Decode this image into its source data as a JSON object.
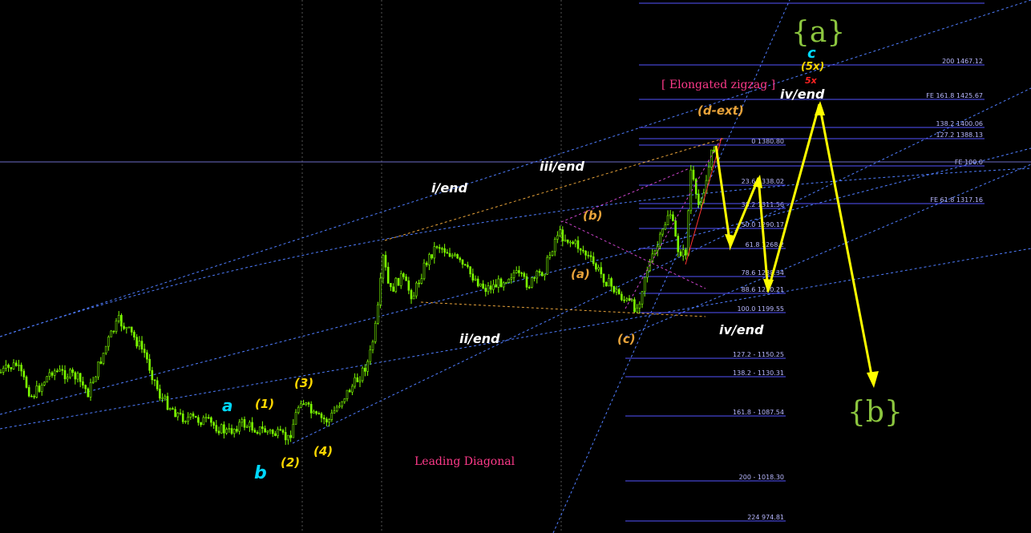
{
  "colors": {
    "background": "#000000",
    "candle": "#7CFC00",
    "fib_line": "#5555ff",
    "fib_text": "#b8b8ff",
    "channel": "#4f7dff",
    "arrow": "#ffff00",
    "white_label": "#ffffff",
    "yellow_label": "#ffd700",
    "cyan_label": "#00d8ff",
    "orange_label": "#e8a33a",
    "khaki_label": "#c9b26b",
    "magenta_label": "#ff44ff",
    "red_label": "#ff2222",
    "pink_text": "#ff3a8a",
    "green_brace": "#8cc63f"
  },
  "chart_data": {
    "type": "line",
    "title": "",
    "fib_levels": [
      {
        "label": "200 1467.12"
      },
      {
        "label": "FE 161.8 1425.67"
      },
      {
        "label": "138.2 1400.06"
      },
      {
        "label": "127.2 1388.13"
      },
      {
        "label": "0 1380.80"
      },
      {
        "label": "FE 100.0"
      },
      {
        "label": "23.6 1338.02"
      },
      {
        "label": "38.2 1311.56"
      },
      {
        "label": "FE 61.8 1317.16"
      },
      {
        "label": "50.0 1290.17"
      },
      {
        "label": "61.8 1268.2"
      },
      {
        "label": "78.6 1238.34"
      },
      {
        "label": "88.6 1220.21"
      },
      {
        "label": "100.0 1199.55"
      },
      {
        "label": "127.2 - 1150.25"
      },
      {
        "label": "138.2 - 1130.31"
      },
      {
        "label": "161.8 - 1087.54"
      },
      {
        "label": "200 - 1018.30"
      },
      {
        "label": "224 974.81"
      }
    ],
    "annotations": {
      "wave_a_brace": "{a}",
      "wave_b_brace": "{b}",
      "c_top": "c",
      "fivex": "(5x)",
      "fivex_red": "5x",
      "iv_end_top": "iv/end",
      "elongated": "[ Elongated zigzag ]",
      "d_ext": "(d-ext)",
      "iii_end": "iii/end",
      "i_end": "i/end",
      "ii_end": "ii/end",
      "iv_end": "iv/end",
      "leading_diagonal": "Leading Diagonal",
      "paren_a": "(a)",
      "paren_b": "(b)",
      "paren_c": "(c)",
      "w1": "(1)",
      "w2": "(2)",
      "w3": "(3)",
      "w4": "(4)",
      "cyan_a": "a",
      "cyan_b": "b"
    }
  }
}
